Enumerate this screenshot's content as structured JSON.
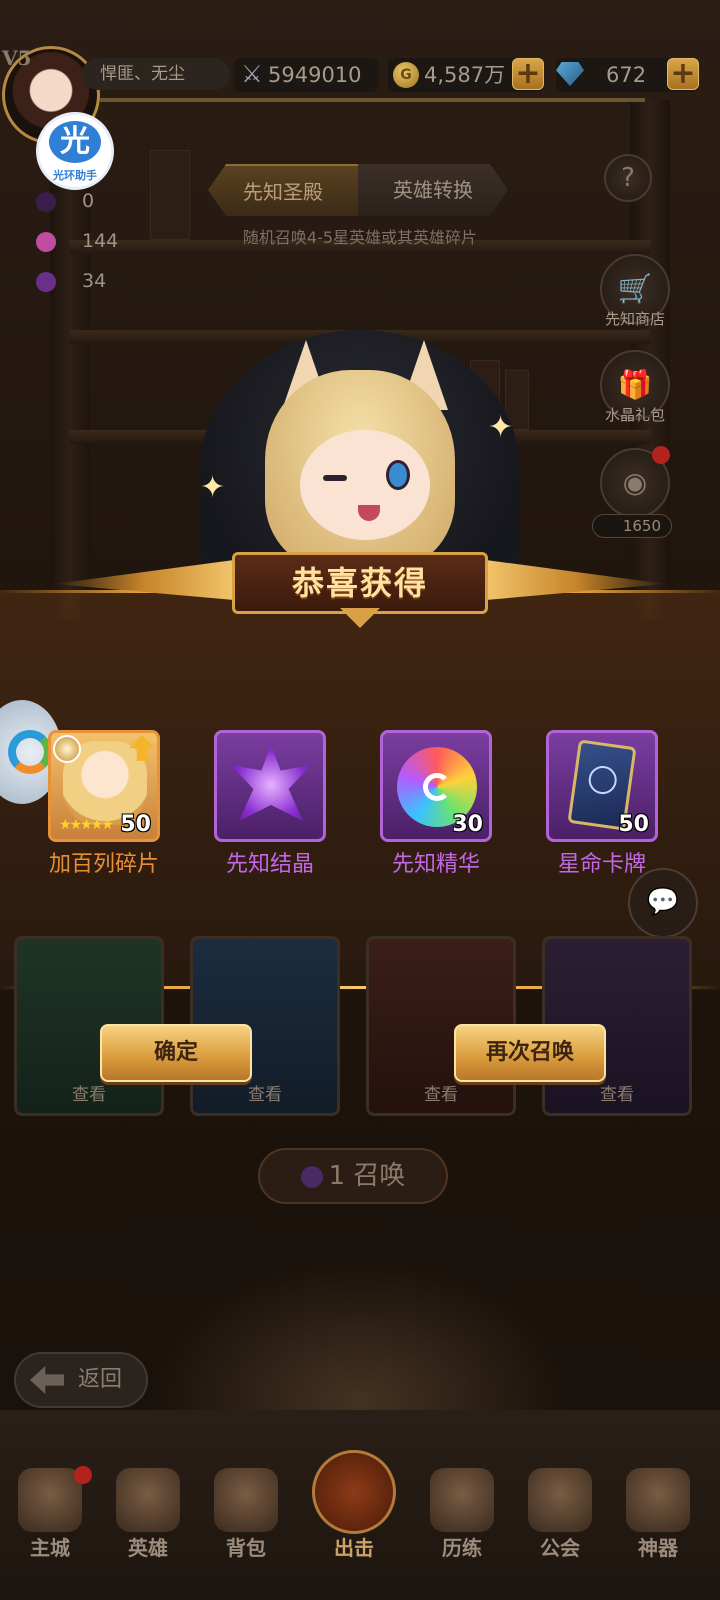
{
  "player": {
    "vip": "V5",
    "name": "悍匪、无尘",
    "power": "5949010",
    "gold": "4,587万",
    "gems": "672"
  },
  "assistant": {
    "glyph": "光",
    "caption": "光环助手"
  },
  "resources": [
    {
      "icon": "dark-orb-icon",
      "value": "0",
      "color": "#3a1f4d"
    },
    {
      "icon": "rainbow-orb-icon",
      "value": "144",
      "color": "#c04ea0"
    },
    {
      "icon": "purple-crystal-icon",
      "value": "34",
      "color": "#6a2f8a"
    }
  ],
  "tabs": [
    {
      "label": "先知圣殿",
      "active": true
    },
    {
      "label": "英雄转换",
      "active": false
    }
  ],
  "subtitle": "随机召唤4-5星英雄或其英雄碎片",
  "side_menu": {
    "help": "?",
    "shop_label": "先知商店",
    "gift_label": "水晶礼包",
    "orb_count": "1650"
  },
  "reward": {
    "banner": "恭喜获得",
    "items": [
      {
        "name": "加百列碎片",
        "count": "50",
        "stars": "★★★★★",
        "rarity": "gold",
        "label_color": "#e88f36",
        "icon": "hero-shard-icon"
      },
      {
        "name": "先知结晶",
        "count": "",
        "rarity": "purple",
        "label_color": "#c267e6",
        "icon": "prophet-crystal-icon"
      },
      {
        "name": "先知精华",
        "count": "30",
        "rarity": "purple",
        "label_color": "#c267e6",
        "icon": "prophet-essence-icon"
      },
      {
        "name": "星命卡牌",
        "count": "50",
        "rarity": "purple",
        "label_color": "#c267e6",
        "icon": "star-card-icon"
      }
    ]
  },
  "cards_behind": {
    "look_label": "查看"
  },
  "buttons": {
    "confirm": "确定",
    "again": "再次召唤"
  },
  "summon": {
    "label": "1 召唤"
  },
  "back": {
    "label": "返回"
  },
  "nav": [
    {
      "label": "主城",
      "icon": "castle-icon"
    },
    {
      "label": "英雄",
      "icon": "hero-icon"
    },
    {
      "label": "背包",
      "icon": "backpack-icon"
    },
    {
      "label": "出击",
      "icon": "crossed-swords-icon"
    },
    {
      "label": "历练",
      "icon": "training-icon"
    },
    {
      "label": "公会",
      "icon": "guild-icon"
    },
    {
      "label": "神器",
      "icon": "artifact-icon"
    }
  ]
}
